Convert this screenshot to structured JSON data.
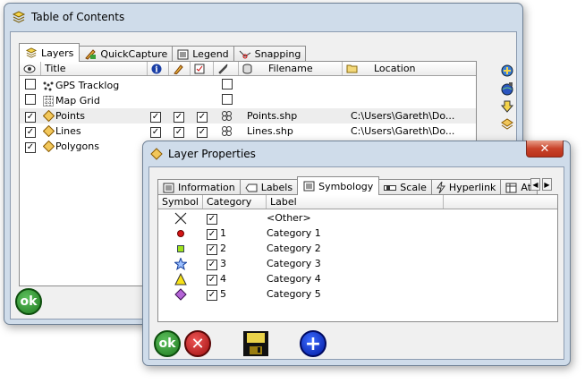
{
  "toc": {
    "title": "Table of Contents",
    "tabs": [
      {
        "label": "Layers",
        "active": true
      },
      {
        "label": "QuickCapture"
      },
      {
        "label": "Legend"
      },
      {
        "label": "Snapping"
      }
    ],
    "columns": {
      "title": "Title",
      "filename": "Filename",
      "location": "Location"
    },
    "rows": [
      {
        "title": "GPS Tracklog",
        "visible": false,
        "filename": "",
        "location": ""
      },
      {
        "title": "Map Grid",
        "visible": false,
        "filename": "",
        "location": ""
      },
      {
        "title": "Points",
        "visible": true,
        "filename": "Points.shp",
        "location": "C:\\Users\\Gareth\\Do..."
      },
      {
        "title": "Lines",
        "visible": true,
        "filename": "Lines.shp",
        "location": "C:\\Users\\Gareth\\Do..."
      },
      {
        "title": "Polygons",
        "visible": true,
        "filename": "",
        "location": ""
      }
    ],
    "ok_label": "ok"
  },
  "props": {
    "title": "Layer Properties",
    "close_glyph": "✕",
    "tabs": [
      {
        "label": "Information"
      },
      {
        "label": "Labels"
      },
      {
        "label": "Symbology",
        "active": true
      },
      {
        "label": "Scale"
      },
      {
        "label": "Hyperlink"
      },
      {
        "label": "Att"
      }
    ],
    "columns": {
      "symbol": "Symbol",
      "category": "Category",
      "label": "Label"
    },
    "rows": [
      {
        "symbol": "x",
        "category": "",
        "label": "<Other>"
      },
      {
        "symbol": "red-circle",
        "category": "1",
        "label": "Category 1"
      },
      {
        "symbol": "green-square",
        "category": "2",
        "label": "Category 2"
      },
      {
        "symbol": "blue-star",
        "category": "3",
        "label": "Category 3"
      },
      {
        "symbol": "yellow-triangle",
        "category": "4",
        "label": "Category 4"
      },
      {
        "symbol": "purple-diamond",
        "category": "5",
        "label": "Category 5"
      }
    ],
    "ok_label": "ok",
    "cancel_glyph": "✕",
    "add_glyph": "+"
  },
  "colors": {
    "titlebar": "#cfdcea",
    "close": "#c9432a",
    "ok": "#1f7a1f",
    "cancel": "#a01010",
    "add": "#0018a0"
  }
}
